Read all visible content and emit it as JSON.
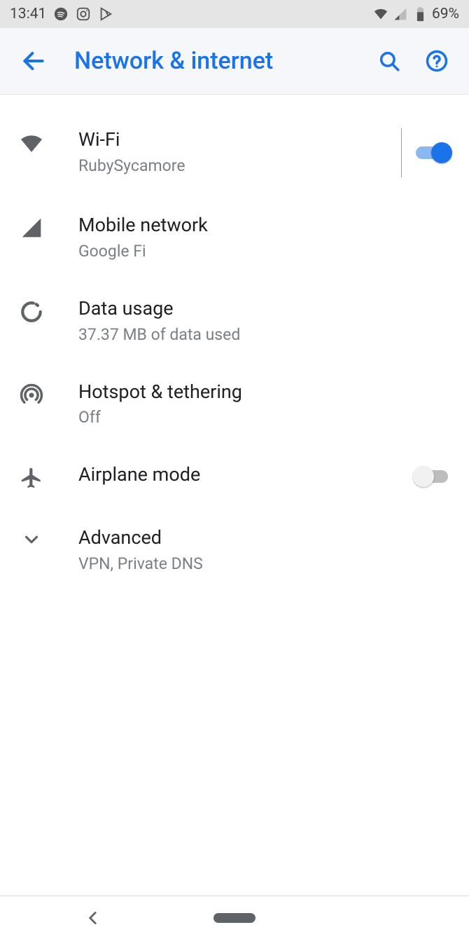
{
  "status": {
    "time": "13:41",
    "battery_pct": "69%"
  },
  "header": {
    "title": "Network & internet"
  },
  "rows": {
    "wifi": {
      "title": "Wi-Fi",
      "subtitle": "RubySycamore"
    },
    "mobile": {
      "title": "Mobile network",
      "subtitle": "Google Fi"
    },
    "data": {
      "title": "Data usage",
      "subtitle": "37.37 MB of data used"
    },
    "hotspot": {
      "title": "Hotspot & tethering",
      "subtitle": "Off"
    },
    "airplane": {
      "title": "Airplane mode"
    },
    "advanced": {
      "title": "Advanced",
      "subtitle": "VPN, Private DNS"
    }
  }
}
